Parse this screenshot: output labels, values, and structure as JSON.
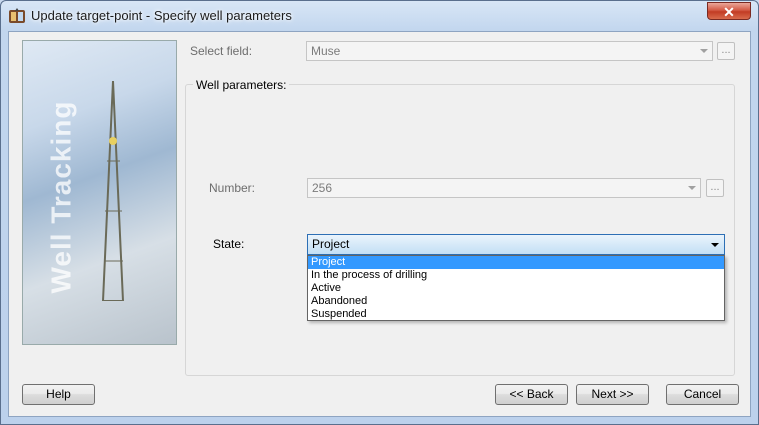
{
  "window": {
    "title": "Update target-point - Specify well parameters",
    "close_label": "✕"
  },
  "banner": {
    "text": "Well Tracking"
  },
  "form": {
    "select_field_label": "Select field:",
    "select_field_value": "Muse",
    "well_parameters_label": "Well parameters:",
    "number_label": "Number:",
    "number_value": "256",
    "state_label": "State:",
    "state_value": "Project",
    "ellipsis_label": "...",
    "state_options": [
      "Project",
      "In the process of drilling",
      "Active",
      "Abandoned",
      "Suspended"
    ]
  },
  "buttons": {
    "help": "Help",
    "back": "<< Back",
    "next": "Next >>",
    "cancel": "Cancel"
  },
  "colors": {
    "selection": "#3399ff",
    "close_button": "#c84a33",
    "frame": "#c2d6ee"
  }
}
